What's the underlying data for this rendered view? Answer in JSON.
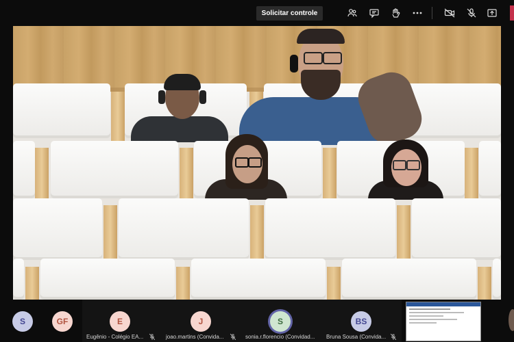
{
  "toolbar": {
    "request_control_label": "Solicitar controle",
    "icons": [
      "people-icon",
      "chat-icon",
      "raise-hand-icon",
      "more-icon",
      "camera-off-icon",
      "mic-off-icon",
      "share-tray-icon"
    ]
  },
  "participants": [
    {
      "initials": "S",
      "name": "",
      "avatar_bg": "#c7cbe6",
      "avatar_fg": "#444791"
    },
    {
      "initials": "GF",
      "name": "",
      "avatar_bg": "#f7d6cf",
      "avatar_fg": "#b0533f"
    },
    {
      "initials": "E",
      "name": "Eugênio - Colégio EA...",
      "avatar_bg": "#f7d6cf",
      "avatar_fg": "#b0533f"
    },
    {
      "initials": "J",
      "name": "joao.martins (Convida...",
      "avatar_bg": "#f7d6cf",
      "avatar_fg": "#b0533f"
    },
    {
      "initials": "S",
      "name": "sonia.r.florencio (Convidad...",
      "avatar_bg": "#cfe6d0",
      "avatar_fg": "#3d6b3f"
    },
    {
      "initials": "BS",
      "name": "Bruna Sousa (Convida...",
      "avatar_bg": "#c7cbe6",
      "avatar_fg": "#444791"
    }
  ]
}
